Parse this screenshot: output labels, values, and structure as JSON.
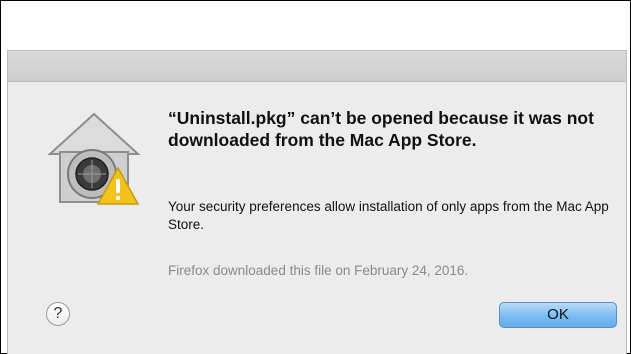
{
  "dialog": {
    "headline": "“Uninstall.pkg” can’t be opened because it was not downloaded from the Mac App Store.",
    "info": "Your security preferences allow installation of only apps from the Mac App Store.",
    "note": "Firefox downloaded this file on February 24, 2016.",
    "help_label": "?",
    "ok_label": "OK",
    "icon": "gatekeeper-house-lock-warning-icon"
  },
  "colors": {
    "dialog_bg": "#ececec",
    "ok_button": "#7bbcf2",
    "warning": "#f5c21b"
  }
}
